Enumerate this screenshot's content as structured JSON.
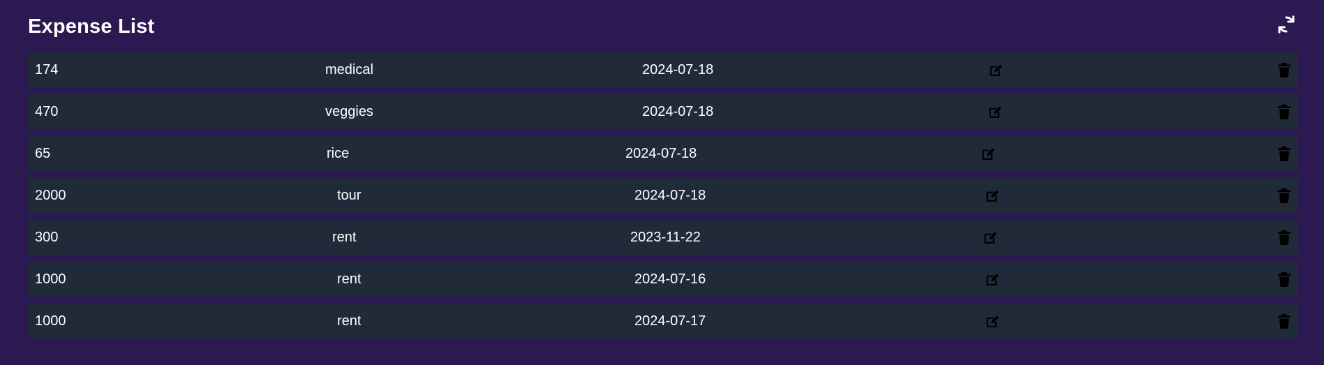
{
  "header": {
    "title": "Expense List",
    "refresh_icon": "refresh-icon"
  },
  "expenses": [
    {
      "amount": "174",
      "category": "medical",
      "date": "2024-07-18"
    },
    {
      "amount": "470",
      "category": "veggies",
      "date": "2024-07-18"
    },
    {
      "amount": "65",
      "category": "rice",
      "date": "2024-07-18"
    },
    {
      "amount": "2000",
      "category": "tour",
      "date": "2024-07-18"
    },
    {
      "amount": "300",
      "category": "rent",
      "date": "2023-11-22"
    },
    {
      "amount": "1000",
      "category": "rent",
      "date": "2024-07-16"
    },
    {
      "amount": "1000",
      "category": "rent",
      "date": "2024-07-17"
    }
  ],
  "icons": {
    "edit": "edit-icon",
    "delete": "trash-icon"
  },
  "colors": {
    "page_background": "#2c1952",
    "row_background": "#202a38",
    "text": "#ffffff",
    "icon": "#000000"
  }
}
